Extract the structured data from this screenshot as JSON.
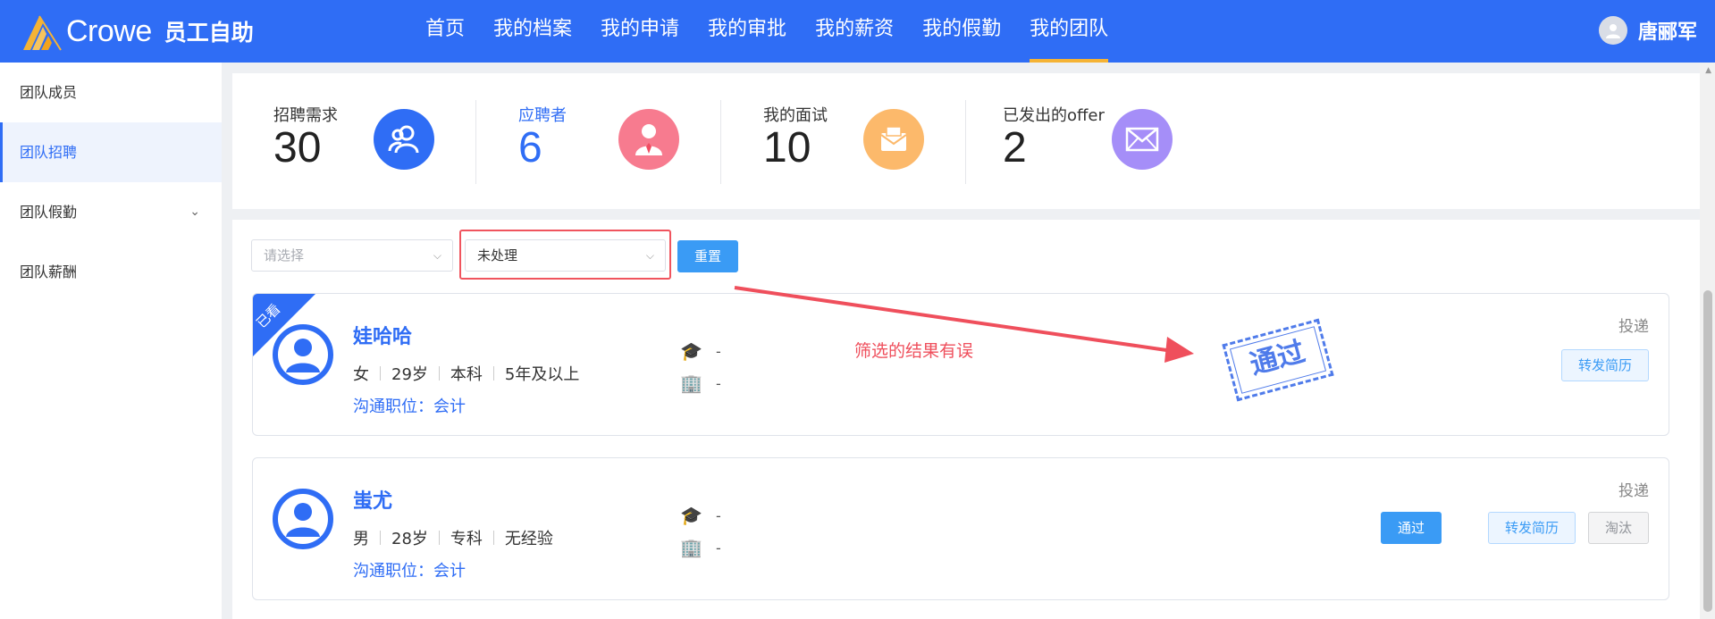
{
  "header": {
    "brand": "Crowe",
    "app_title": "员工自助",
    "nav": [
      "首页",
      "我的档案",
      "我的申请",
      "我的审批",
      "我的薪资",
      "我的假勤",
      "我的团队"
    ],
    "active_nav": "我的团队",
    "accent_color": "#2f6df5",
    "user_name": "唐郦军"
  },
  "sidebar": {
    "items": [
      {
        "label": "团队成员"
      },
      {
        "label": "团队招聘"
      },
      {
        "label": "团队假勤"
      },
      {
        "label": "团队薪酬"
      }
    ],
    "active": "团队招聘"
  },
  "stats": [
    {
      "label": "招聘需求",
      "value": "30",
      "icon": "users-icon",
      "color": "#2f6df5"
    },
    {
      "label": "应聘者",
      "value": "6",
      "icon": "applicant-icon",
      "color": "#f77b8f"
    },
    {
      "label": "我的面试",
      "value": "10",
      "icon": "interview-icon",
      "color": "#fcb96b"
    },
    {
      "label": "已发出的offer",
      "value": "2",
      "icon": "mail-icon",
      "color": "#a58ef8"
    }
  ],
  "filters": {
    "select1_placeholder": "请选择",
    "select2_value": "未处理",
    "reset_label": "重置"
  },
  "candidates": [
    {
      "badge": "已看",
      "name": "娃哈哈",
      "gender": "女",
      "age": "29岁",
      "education": "本科",
      "experience": "5年及以上",
      "position": "沟通职位：会计",
      "school": "-",
      "company": "-",
      "source": "投递",
      "actions": {
        "forward": "转发简历"
      }
    },
    {
      "badge": "",
      "name": "蚩尤",
      "gender": "男",
      "age": "28岁",
      "education": "专科",
      "experience": "无经验",
      "position": "沟通职位：会计",
      "school": "-",
      "company": "-",
      "source": "投递",
      "actions": {
        "pass": "通过",
        "forward": "转发简历",
        "reject": "淘汰"
      }
    }
  ],
  "annotation": {
    "text": "筛选的结果有误",
    "stamp": "通过",
    "color": "#ef4f5c"
  }
}
